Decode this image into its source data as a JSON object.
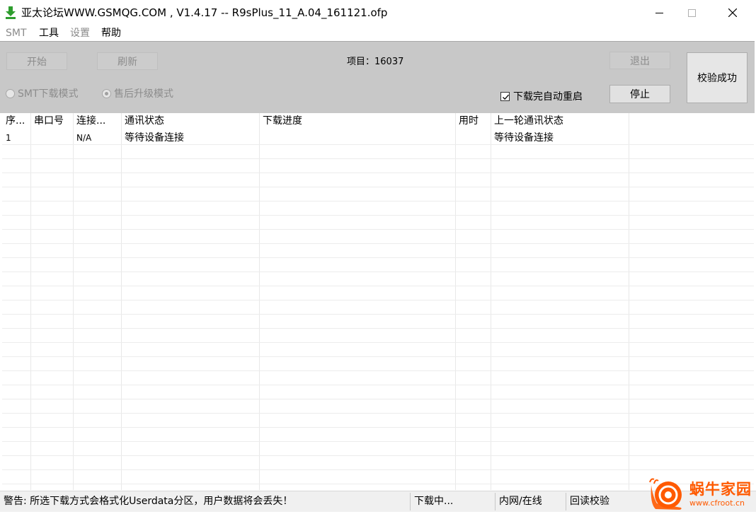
{
  "window": {
    "title": "亚太论坛WWW.GSMQG.COM    , V1.4.17 -- R9sPlus_11_A.04_161121.ofp",
    "icon": "download-arrow-icon",
    "controls": [
      "minimize-icon",
      "maximize-icon",
      "close-icon"
    ]
  },
  "menu": {
    "items": [
      {
        "label": "SMT",
        "enabled": false
      },
      {
        "label": "工具",
        "enabled": true
      },
      {
        "label": "设置",
        "enabled": false
      },
      {
        "label": "帮助",
        "enabled": true
      }
    ]
  },
  "toolbar": {
    "start_label": "开始",
    "refresh_label": "刷新",
    "project_label": "项目：16037",
    "exit_label": "退出",
    "stop_label": "停止",
    "verify_label": "校验成功",
    "radio_smt_label": "SMT下载模式",
    "radio_aftersales_label": "售后升级模式",
    "auto_reboot_label": "下载完自动重启",
    "auto_reboot_checked": true
  },
  "table": {
    "columns": [
      "序...",
      "串口号",
      "连接...",
      "通讯状态",
      "下载进度",
      "用时",
      "上一轮通讯状态"
    ],
    "rows": [
      {
        "index": "1",
        "port": "",
        "connection": "N/A",
        "status": "等待设备连接",
        "progress": "",
        "time": "",
        "last_status": "等待设备连接"
      }
    ]
  },
  "statusbar": {
    "warning": "警告: 所选下载方式会格式化Userdata分区，用户数据将会丢失！",
    "state": "下载中...",
    "network": "内网/在线",
    "readback": "回读校验"
  },
  "watermark": {
    "text": "蜗牛家园",
    "url": "www.cfroot.cn"
  },
  "colors": {
    "panel": "#c8c8c8",
    "accent_green": "#2e9d2e",
    "watermark": "#ff5a00"
  }
}
